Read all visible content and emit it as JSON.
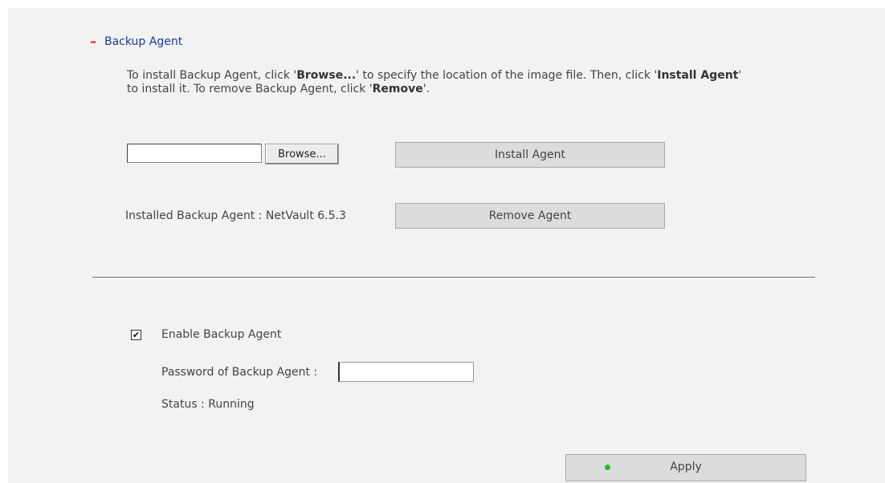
{
  "section": {
    "collapse_icon": "minus-icon",
    "collapse_symbol": "–",
    "title": "Backup Agent",
    "accent_color": "#e02020",
    "title_color": "#1f3a93"
  },
  "description": {
    "p1": "To install Backup Agent, click '",
    "b1": "Browse...",
    "p2": "' to specify the location of the image file. Then, click '",
    "b2": "Install Agent",
    "p3": "'",
    "p4": "to install it. To remove Backup Agent, click '",
    "b3": "Remove",
    "p5": "'."
  },
  "install": {
    "file_value": "",
    "browse_label": "Browse...",
    "install_label": "Install Agent"
  },
  "installed": {
    "label": "Installed Backup Agent : NetVault 6.5.3",
    "remove_label": "Remove Agent"
  },
  "settings": {
    "enable_checked": true,
    "check_symbol": "✔",
    "enable_label": "Enable Backup Agent",
    "password_label": "Password of Backup Agent :",
    "password_value": "",
    "status_text": "Status : Running"
  },
  "apply": {
    "label": "Apply",
    "indicator_color": "#22c02a"
  }
}
